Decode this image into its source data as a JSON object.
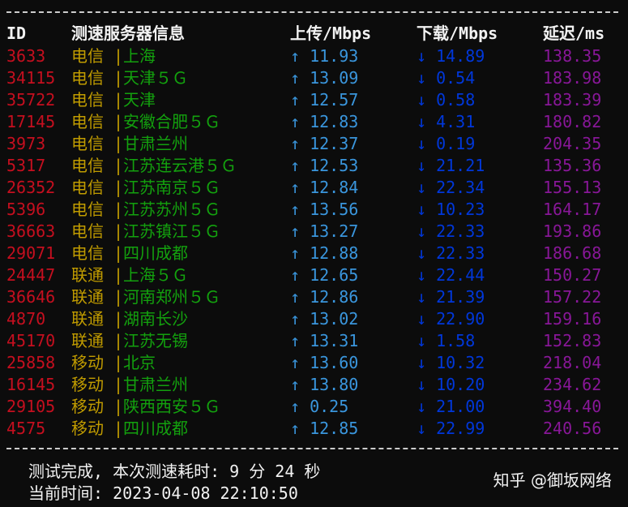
{
  "header": {
    "id": "ID",
    "server": "测速服务器信息",
    "upload": "上传/Mbps",
    "download": "下载/Mbps",
    "latency": "延迟/ms"
  },
  "colors": {
    "background": "#0c0c0c",
    "id": "#c50f1f",
    "isp": "#c19c00",
    "city": "#13a10e",
    "upload": "#3a96dd",
    "download": "#0037da",
    "latency": "#881798",
    "text": "#f2f2f2"
  },
  "rows": [
    {
      "id": "3633",
      "isp": "电信",
      "city": "上海",
      "up": "↑ 11.93",
      "down": "↓ 14.89",
      "lat": "138.35"
    },
    {
      "id": "34115",
      "isp": "电信",
      "city": "天津５Ｇ",
      "up": "↑ 13.09",
      "down": "↓ 0.54",
      "lat": "183.98"
    },
    {
      "id": "35722",
      "isp": "电信",
      "city": "天津",
      "up": "↑ 12.57",
      "down": "↓ 0.58",
      "lat": "183.39"
    },
    {
      "id": "17145",
      "isp": "电信",
      "city": "安徽合肥５Ｇ",
      "up": "↑ 12.83",
      "down": "↓ 4.31",
      "lat": "180.82"
    },
    {
      "id": "3973",
      "isp": "电信",
      "city": "甘肃兰州",
      "up": "↑ 12.37",
      "down": "↓ 0.19",
      "lat": "204.35"
    },
    {
      "id": "5317",
      "isp": "电信",
      "city": "江苏连云港５Ｇ",
      "up": "↑ 12.53",
      "down": "↓ 21.21",
      "lat": "135.36"
    },
    {
      "id": "26352",
      "isp": "电信",
      "city": "江苏南京５Ｇ",
      "up": "↑ 12.84",
      "down": "↓ 22.34",
      "lat": "155.13"
    },
    {
      "id": "5396",
      "isp": "电信",
      "city": "江苏苏州５Ｇ",
      "up": "↑ 13.56",
      "down": "↓ 10.23",
      "lat": "164.17"
    },
    {
      "id": "36663",
      "isp": "电信",
      "city": "江苏镇江５Ｇ",
      "up": "↑ 13.27",
      "down": "↓ 22.33",
      "lat": "193.86"
    },
    {
      "id": "29071",
      "isp": "电信",
      "city": "四川成都",
      "up": "↑ 12.88",
      "down": "↓ 22.33",
      "lat": "186.68"
    },
    {
      "id": "24447",
      "isp": "联通",
      "city": "上海５Ｇ",
      "up": "↑ 12.65",
      "down": "↓ 22.44",
      "lat": "150.27"
    },
    {
      "id": "36646",
      "isp": "联通",
      "city": "河南郑州５Ｇ",
      "up": "↑ 12.86",
      "down": "↓ 21.39",
      "lat": "157.22"
    },
    {
      "id": "4870",
      "isp": "联通",
      "city": "湖南长沙",
      "up": "↑ 13.02",
      "down": "↓ 22.90",
      "lat": "159.16"
    },
    {
      "id": "45170",
      "isp": "联通",
      "city": "江苏无锡",
      "up": "↑ 13.31",
      "down": "↓ 1.58",
      "lat": "152.83"
    },
    {
      "id": "25858",
      "isp": "移动",
      "city": "北京",
      "up": "↑ 13.60",
      "down": "↓ 10.32",
      "lat": "218.04"
    },
    {
      "id": "16145",
      "isp": "移动",
      "city": "甘肃兰州",
      "up": "↑ 13.80",
      "down": "↓ 10.20",
      "lat": "234.62"
    },
    {
      "id": "29105",
      "isp": "移动",
      "city": "陕西西安５Ｇ",
      "up": "↑ 0.25",
      "down": "↓ 21.00",
      "lat": "394.40"
    },
    {
      "id": "4575",
      "isp": "移动",
      "city": "四川成都",
      "up": "↑ 12.85",
      "down": "↓ 22.99",
      "lat": "240.56"
    }
  ],
  "separator": "|",
  "footer": {
    "done": "测试完成, 本次测速耗时: 9 分 24 秒",
    "time": "当前时间: 2023-04-08 22:10:50"
  },
  "watermark": "知乎 @御坂网络"
}
